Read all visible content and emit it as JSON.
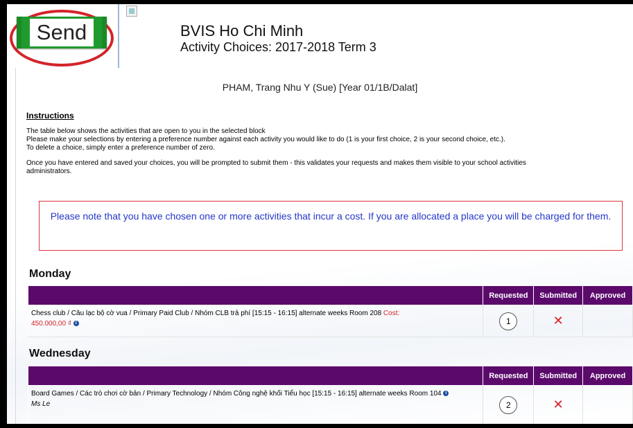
{
  "header": {
    "send_label": "Send",
    "school": "BVIS Ho Chi Minh",
    "term": "Activity Choices: 2017-2018 Term 3"
  },
  "student": "PHAM, Trang Nhu Y (Sue) [Year 01/1B/Dalat]",
  "instructions": {
    "heading": "Instructions",
    "line1": "The table below shows the activities that are open to you in the selected block",
    "line2": "Please make your selections by entering a preference number against each activity you would like to do (1 is your first choice, 2 is your second choice, etc.).",
    "line3": "To delete a choice, simply enter a preference number of zero.",
    "line4": "Once you have entered and saved your choices, you will be prompted to submit them - this validates your requests and makes them visible to your school activities",
    "line5": "administrators."
  },
  "notice": "Please note that you have chosen one or more activities that incur a cost. If you are allocated a place you will be charged for them.",
  "columns": {
    "requested": "Requested",
    "submitted": "Submitted",
    "approved": "Approved"
  },
  "days": [
    {
      "name": "Monday",
      "activity": {
        "text": "Chess club / Câu lạc bộ cờ vua / Primary Paid Club / Nhóm CLB trả phí [15:15 - 16:15] alternate weeks Room 208",
        "cost_label": "Cost:",
        "cost_value": "450.000,00 ₫",
        "preference": "1",
        "submitted": "✕",
        "approved": ""
      }
    },
    {
      "name": "Wednesday",
      "activity": {
        "text": "Board Games / Các trò chơi cờ bản / Primary Technology / Nhóm Công nghệ khối Tiểu học [15:15 - 16:15] alternate weeks Room 104",
        "tutor": "Ms Le",
        "preference": "2",
        "submitted": "✕",
        "approved": ""
      }
    }
  ],
  "colors": {
    "table_header": "#5b0a6b",
    "send_button": "#1f9a2e",
    "annotation_ring": "#d3242a",
    "notice_text": "#2437c8",
    "cost_text": "#d3242a"
  },
  "icons": [
    "broken-image-icon",
    "info-icon",
    "cross-icon"
  ]
}
